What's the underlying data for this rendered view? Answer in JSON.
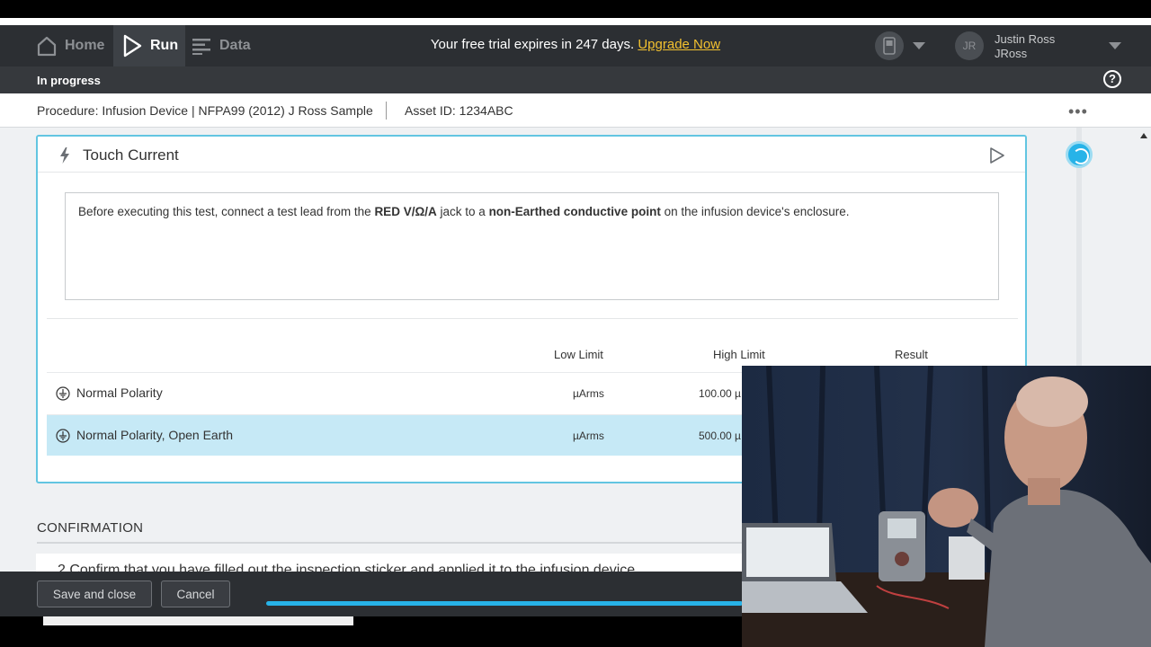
{
  "nav": {
    "home_label": "Home",
    "run_label": "Run",
    "data_label": "Data",
    "trial_text": "Your free trial expires in 247 days.",
    "upgrade_label": "Upgrade Now",
    "user_initials": "JR",
    "user_name": "Justin Ross",
    "user_handle": "JRoss"
  },
  "status": {
    "text": "In progress",
    "help_icon": "?"
  },
  "procedure": {
    "text": "Procedure: Infusion Device | NFPA99 (2012) J Ross Sample",
    "asset": "Asset ID: 1234ABC",
    "more_icon": "•••"
  },
  "test": {
    "title": "Touch Current",
    "instruction_pre": "Before executing this test, connect a test lead from the ",
    "instruction_b1": "RED V/Ω/A",
    "instruction_mid": " jack to a ",
    "instruction_b2": "non-Earthed conductive point",
    "instruction_post": " on the infusion device's enclosure.",
    "columns": {
      "low": "Low Limit",
      "high": "High Limit",
      "result": "Result"
    },
    "rows": [
      {
        "name": "Normal Polarity",
        "unit": "µArms",
        "high": "100.00 µ",
        "selected": false
      },
      {
        "name": "Normal Polarity, Open Earth",
        "unit": "µArms",
        "high": "500.00 µ",
        "selected": true
      }
    ]
  },
  "confirmation": {
    "heading": "CONFIRMATION",
    "step_text": "2   Confirm that you have filled out the inspection sticker and applied it to the infusion device"
  },
  "footer": {
    "save_label": "Save and close",
    "cancel_label": "Cancel",
    "progress": 1.0
  },
  "colors": {
    "accent": "#27b3e8",
    "upgrade": "#f3c12f",
    "nav_bg": "#2c2f33",
    "selected_row": "#c6e9f6"
  },
  "icons": [
    "home-icon",
    "play-icon",
    "list-icon",
    "device-icon",
    "help-icon",
    "bolt-icon",
    "earth-icon",
    "more-icon"
  ]
}
